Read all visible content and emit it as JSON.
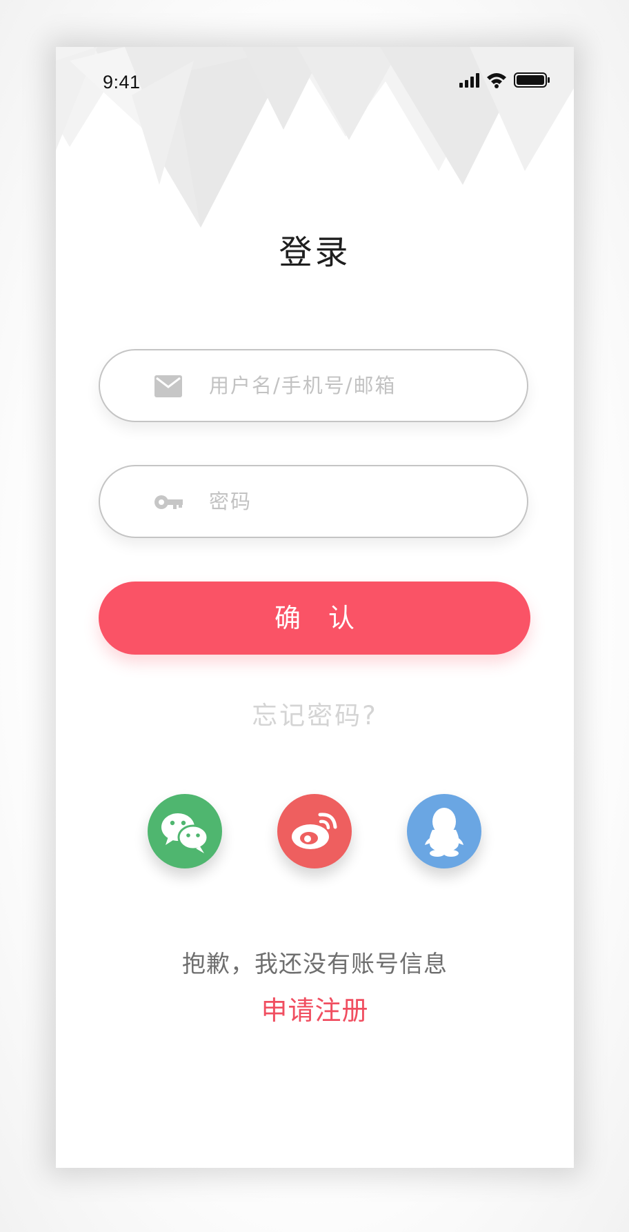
{
  "status_bar": {
    "time": "9:41",
    "icons": [
      "signal-icon",
      "wifi-icon",
      "battery-icon"
    ]
  },
  "page": {
    "title": "登录"
  },
  "form": {
    "username_placeholder": "用户名/手机号/邮箱",
    "username_icon": "mail-icon",
    "password_placeholder": "密码",
    "password_icon": "key-icon",
    "confirm_label": "确 认",
    "forgot_label": "忘记密码?"
  },
  "social_login": [
    {
      "name": "wechat",
      "icon": "wechat-icon",
      "color": "#4fb66f"
    },
    {
      "name": "weibo",
      "icon": "weibo-icon",
      "color": "#ee5f5f"
    },
    {
      "name": "qq",
      "icon": "qq-icon",
      "color": "#6aa6e3"
    }
  ],
  "footer": {
    "no_account_text": "抱歉，我还没有账号信息",
    "register_label": "申请注册"
  },
  "colors": {
    "accent": "#fa5366",
    "register_text": "#f04e60",
    "placeholder": "#c2c2c2",
    "forgot_text": "#d4d4d4"
  }
}
